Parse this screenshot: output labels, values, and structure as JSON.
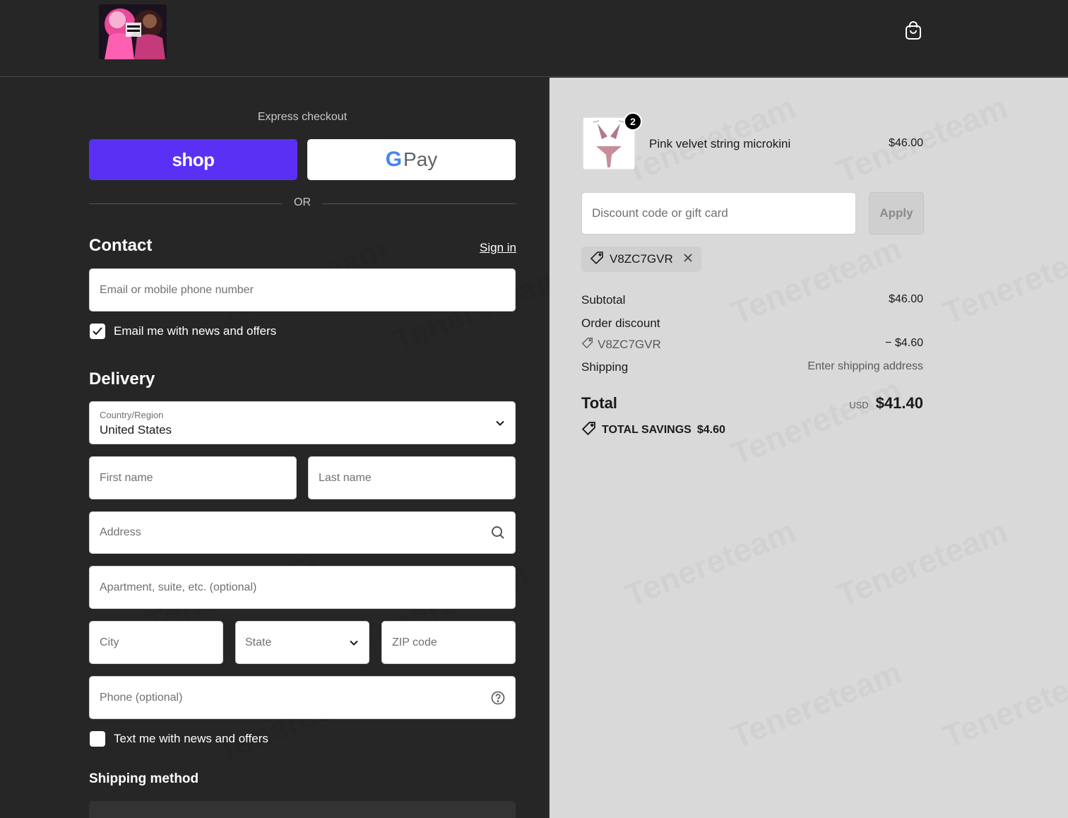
{
  "header": {
    "logo_alt": "store-logo",
    "cart_icon": "shopping-bag-icon"
  },
  "express": {
    "label": "Express checkout",
    "shop_label": "shop",
    "gpay_g": "G",
    "gpay_label": "Pay",
    "or_label": "OR"
  },
  "contact": {
    "title": "Contact",
    "sign_in": "Sign in",
    "email_placeholder": "Email or mobile phone number",
    "news_label": "Email me with news and offers",
    "news_checked": true
  },
  "delivery": {
    "title": "Delivery",
    "country_label": "Country/Region",
    "country_value": "United States",
    "first_name": "First name",
    "last_name": "Last name",
    "address": "Address",
    "apartment": "Apartment, suite, etc. (optional)",
    "city": "City",
    "state": "State",
    "zip": "ZIP code",
    "phone": "Phone (optional)",
    "text_label": "Text me with news and offers",
    "text_checked": false
  },
  "shipping_method": {
    "title": "Shipping method"
  },
  "summary": {
    "item_name": "Pink velvet string microkini",
    "item_price": "$46.00",
    "item_qty": "2",
    "discount_placeholder": "Discount code or gift card",
    "apply_label": "Apply",
    "applied_code": "V8ZC7GVR",
    "subtotal_label": "Subtotal",
    "subtotal_value": "$46.00",
    "order_discount_label": "Order discount",
    "discount_code": "V8ZC7GVR",
    "discount_value": "− $4.60",
    "shipping_label": "Shipping",
    "shipping_value": "Enter shipping address",
    "total_label": "Total",
    "currency": "USD",
    "total_value": "$41.40",
    "savings_label": "TOTAL SAVINGS",
    "savings_value": "$4.60"
  },
  "colors": {
    "shop_purple": "#5a31f4",
    "dark_bg": "#262626",
    "summary_bg": "#d9d9d9"
  }
}
